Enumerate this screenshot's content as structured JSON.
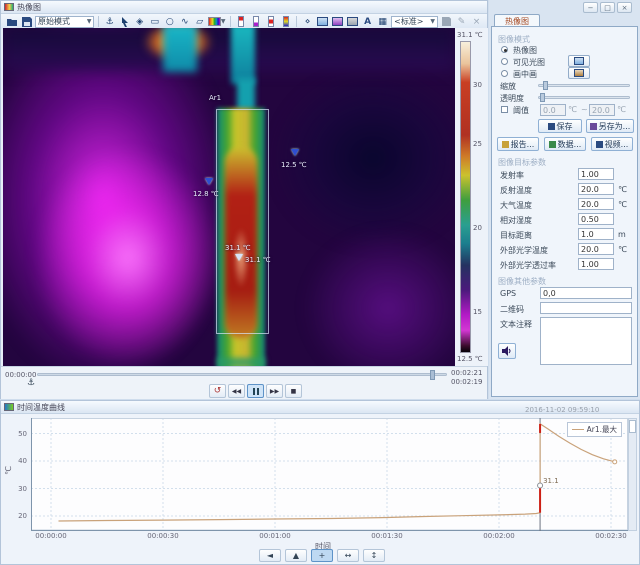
{
  "window": {
    "title": "热像图"
  },
  "toolbar": {
    "mode_select": "原始模式",
    "template_select": "<标准>"
  },
  "glyphs": {
    "anchor": "⚓",
    "spot": "◈",
    "rect": "▭",
    "ellipse": "○",
    "polyline": "∿",
    "polygon": "▱",
    "text_note": "A",
    "grid": "▦",
    "dot_marker": "⋄",
    "minimize": "−",
    "float": "□",
    "close": "×",
    "replay": "↺",
    "step_back": "◀◀",
    "step_fwd": "▶▶",
    "stop": "■",
    "scroll_left": "◄",
    "cursor_tool": "▲",
    "pan": "+",
    "zoom_h": "↔",
    "zoom_v": "↕",
    "tilde": "~"
  },
  "thermal_view": {
    "area_label": "Ar1",
    "marker_left": "12.8 ℃",
    "marker_right": "12.5 ℃",
    "marker_hot_a": "31.1 ℃",
    "marker_hot_b": "31.1 ℃",
    "scale": {
      "max": "31.1 ℃",
      "min": "12.5 ℃",
      "ticks": [
        "30",
        "25",
        "20",
        "15"
      ]
    }
  },
  "playback": {
    "elapsed": "00:00:00",
    "total": "00:02:21",
    "current": "00:02:19"
  },
  "right_panel": {
    "tab": "热像图",
    "image_mode": {
      "title": "图像模式",
      "radio_thermal": "热像图",
      "radio_visible": "可见光图",
      "radio_pip": "画中画",
      "zoom_label": "缩放",
      "opacity_label": "透明度",
      "threshold_label": "阈值",
      "threshold_low": "0.0",
      "threshold_high": "20.0",
      "unit_c": "℃",
      "range_sep": "~",
      "save": "保存",
      "save_as": "另存为...",
      "report": "报告...",
      "data": "数据...",
      "video": "视频..."
    },
    "object_params": {
      "title": "图像目标参数",
      "rows": [
        {
          "label": "发射率",
          "value": "1.00",
          "unit": ""
        },
        {
          "label": "反射温度",
          "value": "20.0",
          "unit": "℃"
        },
        {
          "label": "大气温度",
          "value": "20.0",
          "unit": "℃"
        },
        {
          "label": "相对湿度",
          "value": "0.50",
          "unit": ""
        },
        {
          "label": "目标距离",
          "value": "1.0",
          "unit": "m"
        },
        {
          "label": "外部光学温度",
          "value": "20.0",
          "unit": "℃"
        },
        {
          "label": "外部光学透过率",
          "value": "1.00",
          "unit": ""
        }
      ]
    },
    "other_params": {
      "title": "图像其他参数",
      "gps_label": "GPS",
      "gps_value": "0,0",
      "qr_label": "二维码",
      "note_label": "文本注释"
    }
  },
  "chart_panel": {
    "title": "时间温度曲线",
    "tooltip": "2016-11-02 09:59:10",
    "legend": "Ar1.最大",
    "xaxis_title": "时间"
  },
  "chart_data": {
    "type": "line",
    "title": "时间温度曲线",
    "xlabel": "时间",
    "ylabel": "℃",
    "x_ticks": [
      {
        "t": 0,
        "label": "00:00:00"
      },
      {
        "t": 30,
        "label": "00:00:30"
      },
      {
        "t": 60,
        "label": "00:01:00"
      },
      {
        "t": 90,
        "label": "00:01:30"
      },
      {
        "t": 120,
        "label": "00:02:00"
      },
      {
        "t": 150,
        "label": "00:02:30"
      }
    ],
    "y_ticks": [
      20,
      30,
      40,
      50
    ],
    "ylim": [
      14.9,
      55.6
    ],
    "xlim_seconds": [
      -5.4,
      154.6
    ],
    "grid": true,
    "legend_position": "top-right",
    "series": [
      {
        "name": "Ar1.最大",
        "color": "#c9a27a",
        "points": [
          [
            2,
            18.2
          ],
          [
            15,
            18.35
          ],
          [
            30,
            18.5
          ],
          [
            45,
            18.7
          ],
          [
            60,
            18.9
          ],
          [
            75,
            19.1
          ],
          [
            90,
            19.45
          ],
          [
            100,
            19.8
          ],
          [
            110,
            20.1
          ],
          [
            120,
            20.4
          ],
          [
            127,
            20.7
          ],
          [
            130,
            20.9
          ],
          [
            131,
            21.2
          ],
          [
            131,
            53.5
          ],
          [
            133,
            51.8
          ],
          [
            136,
            49.0
          ],
          [
            139,
            46.5
          ],
          [
            142,
            44.2
          ],
          [
            145,
            42.3
          ],
          [
            148,
            40.8
          ],
          [
            151,
            39.7
          ]
        ]
      }
    ],
    "cursor": {
      "t": 131,
      "value": 31.1,
      "label": "31.1",
      "red_segments": [
        [
          21.2,
          31.1
        ],
        [
          50.2,
          53.5
        ]
      ]
    },
    "end_marker": [
      151,
      39.7
    ]
  }
}
